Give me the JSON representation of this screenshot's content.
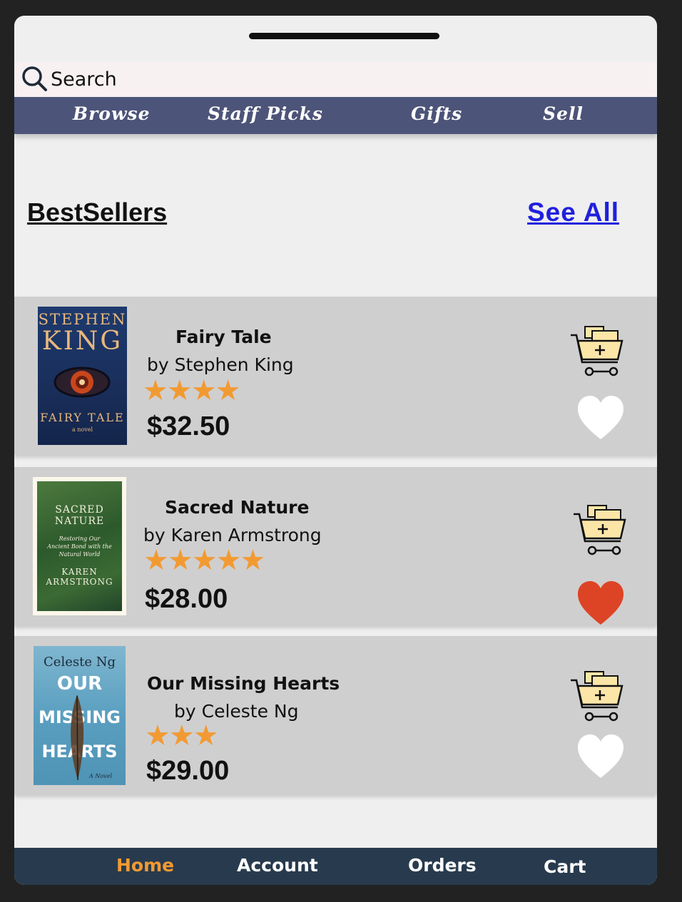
{
  "search": {
    "label": "Search",
    "icon": "search-icon"
  },
  "nav": {
    "items": [
      {
        "label": "Browse"
      },
      {
        "label": "Staff Picks"
      },
      {
        "label": "Gifts"
      },
      {
        "label": "Sell"
      }
    ]
  },
  "section": {
    "title": "BestSellers",
    "see_all": "See All"
  },
  "books": [
    {
      "title": "Fairy Tale",
      "author": "by Stephen King",
      "rating": 4,
      "stars": "★★★★",
      "price": "$32.50",
      "favorited": false,
      "cover": {
        "line1": "STEPHEN",
        "line2": "KING",
        "line3": "FAIRY TALE",
        "line4": "a novel"
      }
    },
    {
      "title": "Sacred Nature",
      "author": "by Karen Armstrong",
      "rating": 5,
      "stars": "★★★★★",
      "price": "$28.00",
      "favorited": true,
      "cover": {
        "line1": "SACRED",
        "line2": "NATURE",
        "line3": "Restoring Our",
        "line4": "Ancient Bond with the",
        "line5": "Natural World",
        "line6": "KAREN",
        "line7": "ARMSTRONG"
      }
    },
    {
      "title": "Our Missing Hearts",
      "author": "by Celeste Ng",
      "rating": 3,
      "stars": "★★★",
      "price": "$29.00",
      "favorited": false,
      "cover": {
        "line1": "Celeste Ng",
        "line2": "OUR",
        "line3": "MISSING",
        "line4": "HEARTS",
        "line5": "A Novel"
      }
    }
  ],
  "tabs": [
    {
      "label": "Home",
      "active": true
    },
    {
      "label": "Account",
      "active": false
    },
    {
      "label": "Orders",
      "active": false
    },
    {
      "label": "Cart",
      "active": false
    }
  ],
  "colors": {
    "nav_bg": "#4d5479",
    "tab_bg": "#283b4e",
    "tab_active": "#f29a32",
    "star": "#f29a32",
    "heart_active": "#dd4425",
    "heart_inactive": "#ffffff",
    "link": "#2020dd"
  }
}
